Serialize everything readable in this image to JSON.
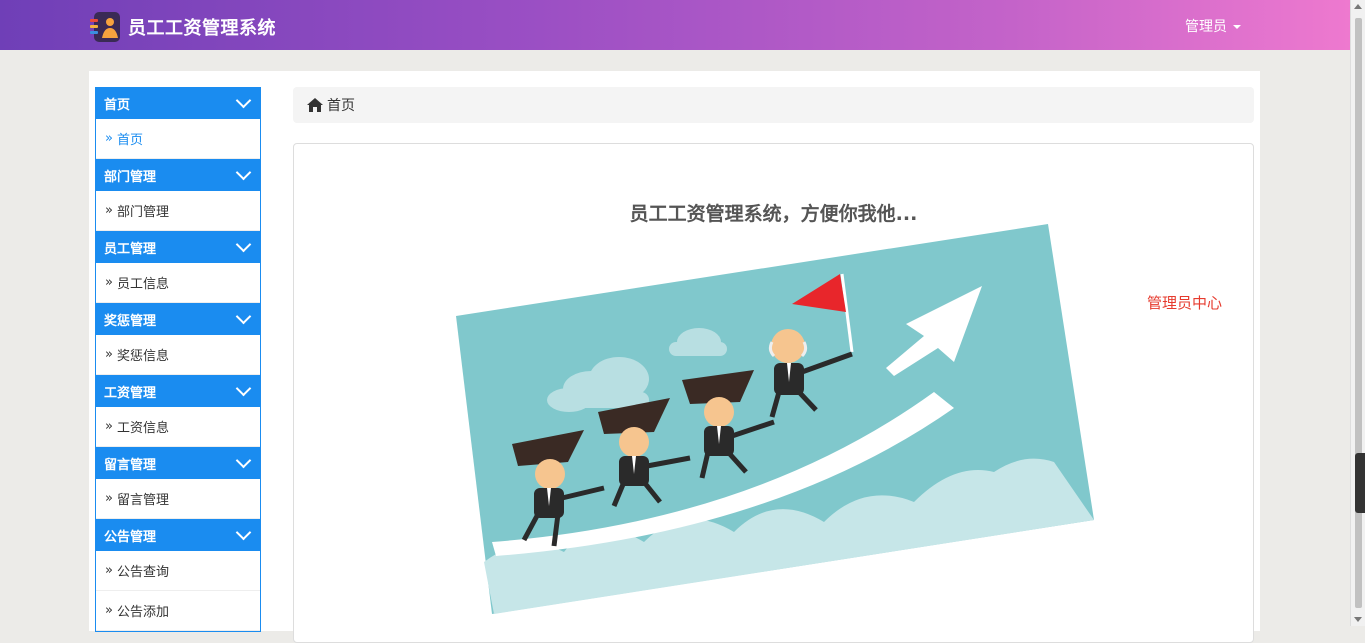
{
  "header": {
    "app_title": "员工工资管理系统",
    "user_menu_label": "管理员",
    "logo_icon": "person-stack-icon"
  },
  "sidebar": {
    "groups": [
      {
        "title": "首页",
        "items": [
          "首页"
        ]
      },
      {
        "title": "部门管理",
        "items": [
          "部门管理"
        ]
      },
      {
        "title": "员工管理",
        "items": [
          "员工信息"
        ]
      },
      {
        "title": "奖惩管理",
        "items": [
          "奖惩信息"
        ]
      },
      {
        "title": "工资管理",
        "items": [
          "工资信息"
        ]
      },
      {
        "title": "留言管理",
        "items": [
          "留言管理"
        ]
      },
      {
        "title": "公告管理",
        "items": [
          "公告查询",
          "公告添加"
        ]
      }
    ],
    "active_item": "首页"
  },
  "breadcrumb": {
    "label": "首页"
  },
  "main": {
    "welcome_text": "员工工资管理系统，方便你我他...",
    "admin_center_link": "管理员中心"
  },
  "colors": {
    "accent": "#1a8cf0",
    "header_gradient_start": "#6f3fb7",
    "header_gradient_end": "#ee79cf",
    "link_red": "#e63b2e"
  }
}
